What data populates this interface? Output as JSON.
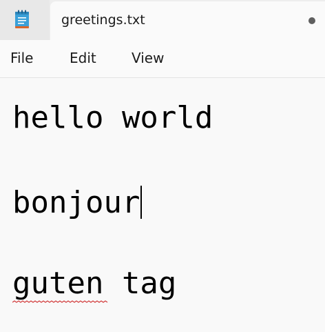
{
  "window": {
    "app_icon": "notepad-icon",
    "tab_title": "greetings.txt",
    "unsaved_indicator": "dot-icon"
  },
  "menu": {
    "items": [
      {
        "label": "File"
      },
      {
        "label": "Edit"
      },
      {
        "label": "View"
      }
    ]
  },
  "editor": {
    "lines": [
      {
        "text": "hello world"
      },
      {
        "text": "bonjour"
      },
      {
        "text": "guten tag"
      }
    ],
    "caret_after_line": 1,
    "misspelled_word": "guten",
    "spellcheck_color": "#d23a3a"
  },
  "colors": {
    "text": "#000000",
    "chrome_bg": "#eeeeee",
    "editor_bg": "#f9f9f9",
    "icon_blue": "#3aa0d8",
    "icon_orange": "#d9662b"
  }
}
